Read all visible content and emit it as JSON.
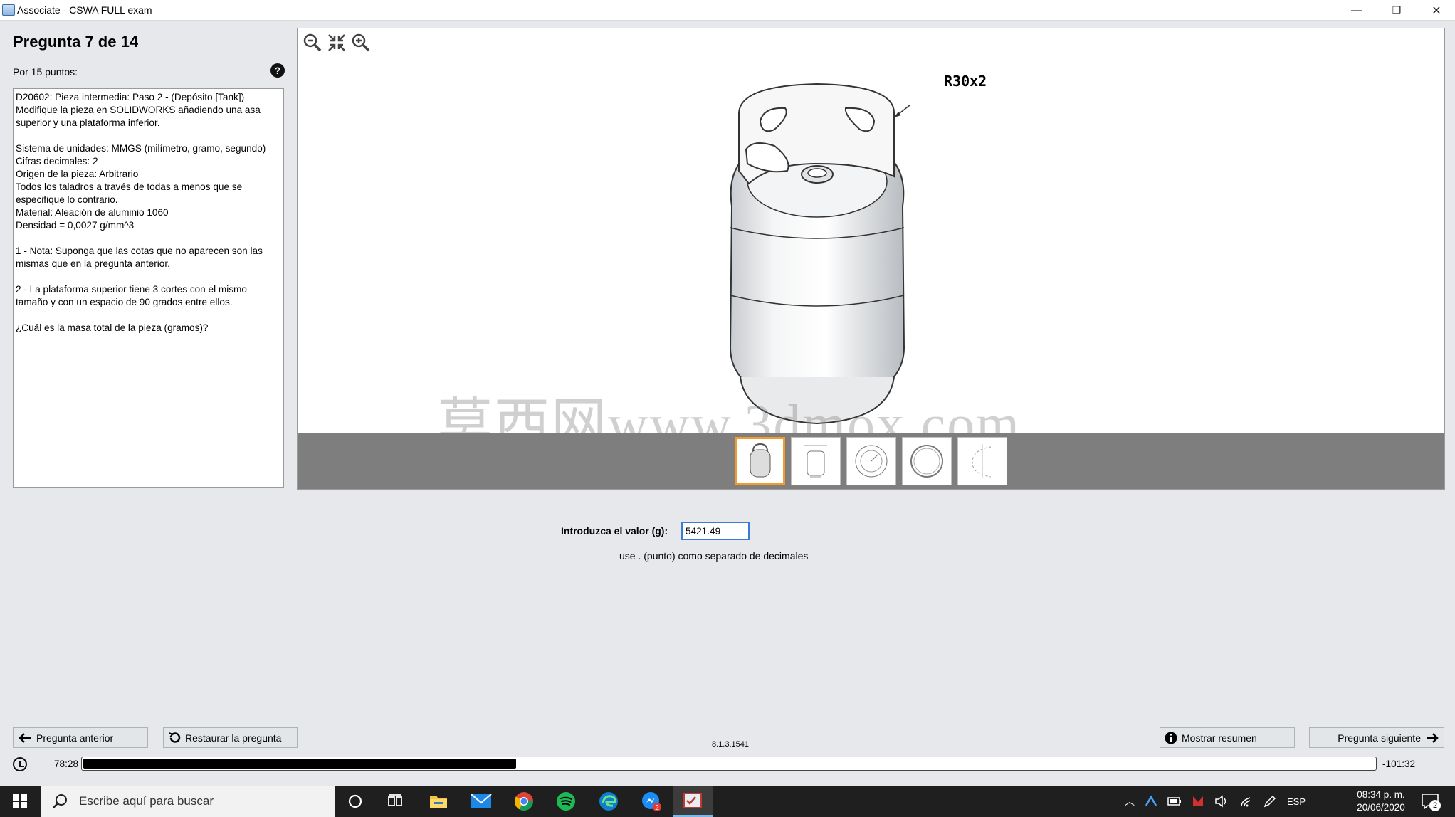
{
  "window": {
    "title": "Associate - CSWA FULL exam",
    "minimize": "—",
    "restore": "❐",
    "close": "✕"
  },
  "question": {
    "title": "Pregunta 7 de 14",
    "points": "Por 15 puntos:",
    "help": "?",
    "paragraphs": [
      "D20602:  Pieza intermedia: Paso 2 - (Depósito [Tank]) Modifique la pieza en SOLIDWORKS añadiendo una asa superior y una plataforma inferior.",
      "Sistema de unidades: MMGS (milímetro, gramo, segundo)\nCifras decimales: 2\nOrigen de la pieza: Arbitrario\nTodos los taladros a través de todas a menos que se especifique lo contrario.\nMaterial: Aleación de aluminio 1060\nDensidad = 0,0027 g/mm^3",
      "1 - Nota: Suponga que las cotas que no aparecen son las mismas que en la pregunta anterior.",
      "2 - La plataforma superior tiene 3 cortes con el mismo tamaño y con un espacio de 90 grados entre ellos.",
      "¿Cuál es la masa total de la pieza (gramos)?"
    ]
  },
  "viewer": {
    "tools": [
      "zoom-out-icon",
      "fit-icon",
      "zoom-in-icon"
    ],
    "dimension_label": "R30x2",
    "watermark": "莫西网www.3dmox.com",
    "thumbnails": [
      "tank-iso",
      "tank-front",
      "top-view",
      "top-view-2",
      "section-detail"
    ],
    "active_thumbnail": 0
  },
  "answer": {
    "label": "Introduzca el valor (g):",
    "value": "5421.49",
    "hint": "use . (punto) como separado de decimales"
  },
  "buttons": {
    "prev": "Pregunta anterior",
    "reset": "Restaurar la pregunta",
    "summary": "Mostrar resumen",
    "next": "Pregunta siguiente"
  },
  "version": "8.1.3.1541",
  "timer": {
    "elapsed": "78:28",
    "remaining": "-101:32",
    "progress_fraction": 0.335
  },
  "taskbar": {
    "search_placeholder": "Escribe aquí para buscar",
    "language": "ESP",
    "time": "08:34 p. m.",
    "date": "20/06/2020",
    "notifications": "2",
    "app_badge": "2"
  },
  "colors": {
    "accent": "#f39c2b",
    "input_border": "#3a7bd5",
    "taskbar": "#1f1f1f"
  }
}
